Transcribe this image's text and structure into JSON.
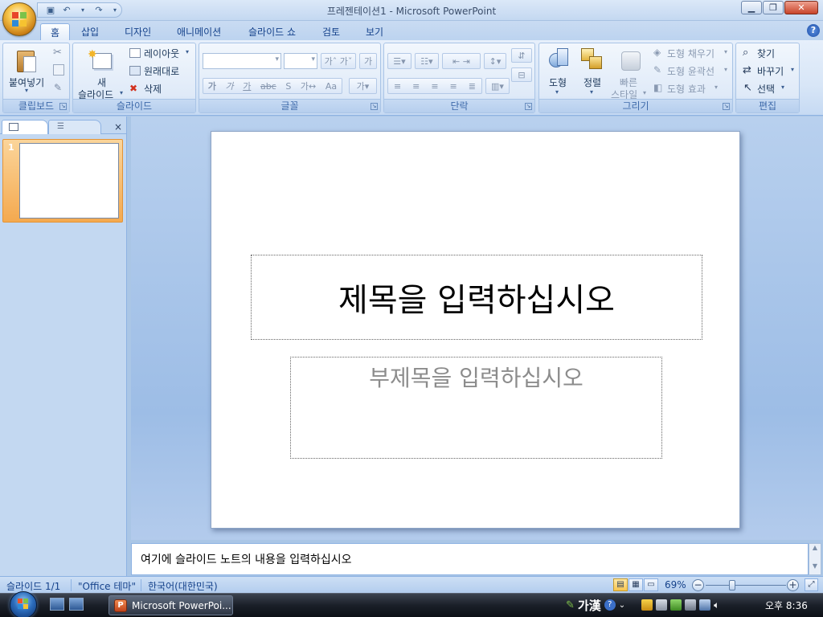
{
  "window": {
    "title": "프레젠테이션1 - Microsoft PowerPoint",
    "minimize_icon": "minimize-icon",
    "maximize_icon": "restore-icon",
    "close_icon": "close-icon"
  },
  "tabs": [
    {
      "label": "홈",
      "active": true
    },
    {
      "label": "삽입"
    },
    {
      "label": "디자인"
    },
    {
      "label": "애니메이션"
    },
    {
      "label": "슬라이드 쇼"
    },
    {
      "label": "검토"
    },
    {
      "label": "보기"
    }
  ],
  "ribbon": {
    "clipboard": {
      "label": "클립보드",
      "paste": "붙여넣기"
    },
    "slides": {
      "label": "슬라이드",
      "new_line1": "새",
      "new_line2": "슬라이드",
      "layout": "레이아웃",
      "reset": "원래대로",
      "delete": "삭제"
    },
    "font": {
      "label": "글꼴"
    },
    "paragraph": {
      "label": "단락"
    },
    "drawing": {
      "label": "그리기",
      "shape": "도형",
      "arrange": "정렬",
      "quick1": "빠른",
      "quick2": "스타일",
      "fill": "도형 채우기",
      "outline": "도형 윤곽선",
      "effect": "도형 효과"
    },
    "editing": {
      "label": "편집",
      "find": "찾기",
      "replace": "바꾸기",
      "select": "선택"
    }
  },
  "slide": {
    "title_placeholder": "제목을 입력하십시오",
    "subtitle_placeholder": "부제목을 입력하십시오",
    "thumbnail_number": "1"
  },
  "notes": {
    "placeholder": "여기에 슬라이드 노트의 내용을 입력하십시오"
  },
  "status": {
    "slide": "슬라이드 1/1",
    "theme": "\"Office 테마\"",
    "language": "한국어(대한민국)",
    "zoom": "69%"
  },
  "taskbar": {
    "app_label": "Microsoft PowerPoi...",
    "ime": "가漢",
    "clock": "오후 8:36"
  }
}
